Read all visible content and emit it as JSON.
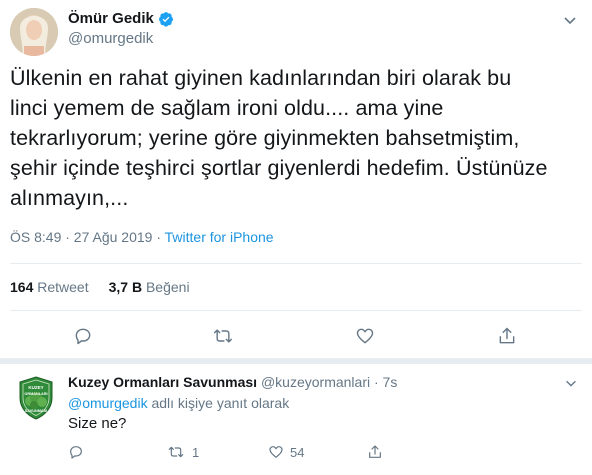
{
  "main_tweet": {
    "author_name": "Ömür Gedik",
    "author_handle": "@omurgedik",
    "text": "Ülkenin en rahat giyinen kadınlarından biri olarak bu\nlinci yemem de sağlam ironi oldu.... ama yine\ntekrarlıyorum; yerine göre giyinmekten bahsetmiştim,\nşehir içinde teşhirci şortlar giyenlerdi hedefim. Üstünüze\nalınmayın,...",
    "timestamp": "ÖS 8:49 · 27 Ağu 2019 · ",
    "source": "Twitter for iPhone",
    "retweet_count": "164",
    "retweet_label": "Retweet",
    "like_count": "3,7 B",
    "like_label": "Beğeni"
  },
  "reply": {
    "author_name": "Kuzey Ormanları Savunması",
    "author_handle": "@kuzeyormanlari",
    "time": "· 7s",
    "replying_mention": "@omurgedik",
    "replying_suffix": " adlı kişiye yanıt olarak",
    "text": "Size ne?",
    "retweet_count": "1",
    "like_count": "54",
    "avatar_text_top": "KUZEY",
    "avatar_text_mid": "ORMANLARI",
    "avatar_text_bot": "SAVUNMASI"
  },
  "colors": {
    "accent": "#1b95e0",
    "muted": "#657786",
    "verified": "#1da1f2",
    "badge_green": "#2f8a3a"
  },
  "icons": [
    "verified-badge-icon",
    "chevron-down-icon",
    "reply-icon",
    "retweet-icon",
    "like-icon",
    "share-icon"
  ]
}
